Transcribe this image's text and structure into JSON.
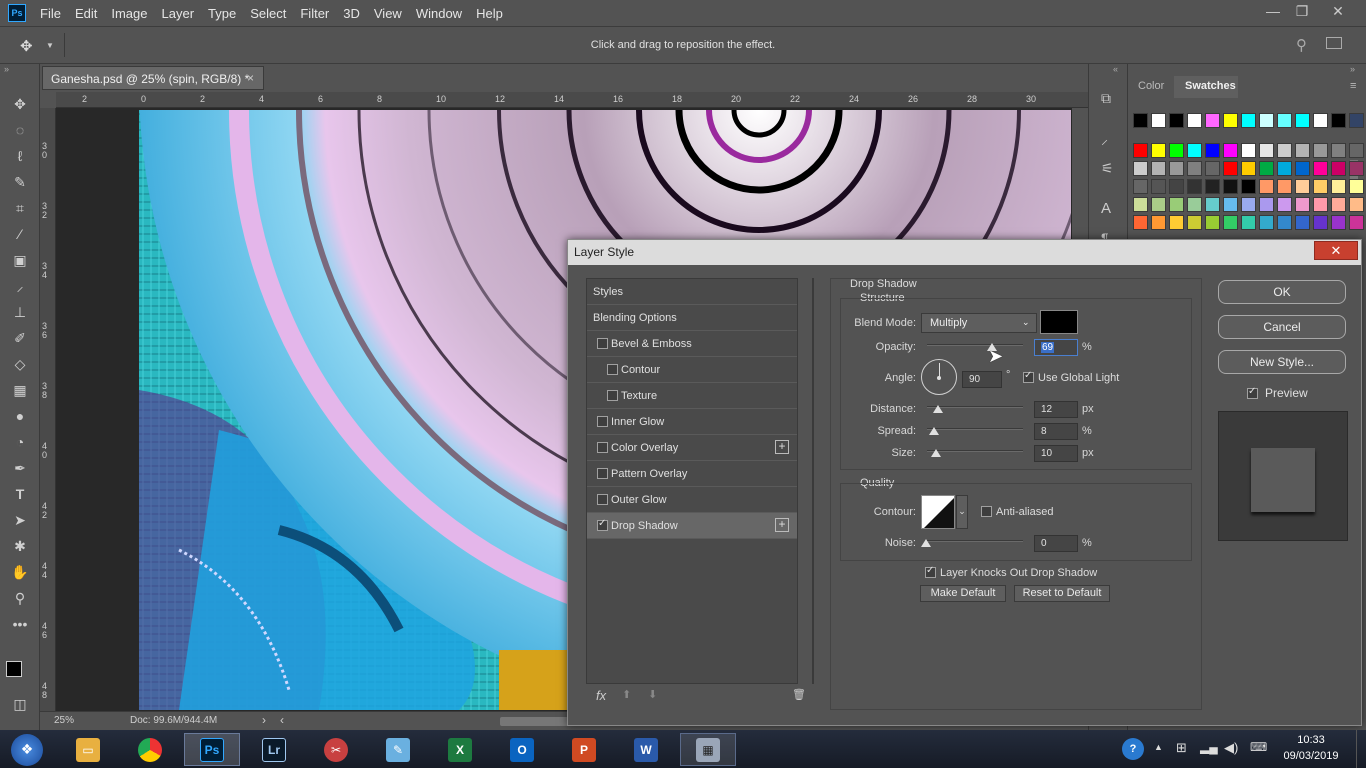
{
  "app": {
    "logo_text": "Ps"
  },
  "menu": [
    "File",
    "Edit",
    "Image",
    "Layer",
    "Type",
    "Select",
    "Filter",
    "3D",
    "View",
    "Window",
    "Help"
  ],
  "window_controls": {
    "minimize": "—",
    "restore": "❐",
    "close": "✕"
  },
  "options_bar": {
    "hint": "Click and drag to reposition the effect."
  },
  "document_tab": {
    "title": "Ganesha.psd @ 25% (spin, RGB/8) *",
    "close": "×"
  },
  "ruler_top": [
    "2",
    "0",
    "2",
    "4",
    "6",
    "8",
    "10",
    "12",
    "14",
    "16",
    "18",
    "20",
    "22",
    "24",
    "26",
    "28",
    "30"
  ],
  "ruler_left": [
    "3 0",
    "3 2",
    "3 4",
    "3 6",
    "3 8",
    "4 0",
    "4 2",
    "4 4",
    "4 6",
    "4 8"
  ],
  "status_bar": {
    "zoom": "25%",
    "doc": "Doc: 99.6M/944.4M"
  },
  "panels": {
    "color_tab": "Color",
    "swatches_tab": "Swatches"
  },
  "swatch_colors": {
    "row1": [
      "#000000",
      "#ffffff",
      "#000000",
      "#ffffff",
      "#ff66ff",
      "#ffff00",
      "#00ffff",
      "#ccffff",
      "#66ffff",
      "#00ffff",
      "#ffffff",
      "#000000",
      "#334466",
      "#222266"
    ],
    "row2": [
      "#ff0000",
      "#ffff00",
      "#00ff00",
      "#00ffff",
      "#0000ff",
      "#ff00ff",
      "#ffffff",
      "#e6e6e6",
      "#cccccc",
      "#b3b3b3",
      "#999999",
      "#808080",
      "#666666"
    ],
    "row3": [
      "#cccccc",
      "#b3b3b3",
      "#999999",
      "#808080",
      "#666666",
      "#ff0000",
      "#ffcc00",
      "#00aa44",
      "#00aadd",
      "#0066cc",
      "#ff0099",
      "#cc0066",
      "#993366"
    ],
    "row4": [
      "#666666",
      "#555555",
      "#444444",
      "#333333",
      "#222222",
      "#111111",
      "#000000",
      "#ff9966",
      "#ff9966",
      "#ffcc99",
      "#ffcc66",
      "#ffee99",
      "#ffff99"
    ],
    "row5": [
      "#ccdd99",
      "#aacc88",
      "#99cc77",
      "#99cc99",
      "#66cccc",
      "#66bbee",
      "#99aaee",
      "#aa99ee",
      "#cc99ee",
      "#ee99cc",
      "#ff99aa",
      "#ffaa99",
      "#ffbb88"
    ],
    "row6": [
      "#ff6633",
      "#ff9933",
      "#ffcc33",
      "#cccc33",
      "#99cc33",
      "#33cc66",
      "#33ccaa",
      "#33aacc",
      "#3388cc",
      "#3366cc",
      "#6633cc",
      "#9933cc",
      "#cc3399"
    ]
  },
  "dialog": {
    "title": "Layer Style",
    "close": "✕",
    "styles": [
      {
        "label": "Styles",
        "checkbox": false,
        "plus": false,
        "indent": 0
      },
      {
        "label": "Blending Options",
        "checkbox": false,
        "plus": false,
        "indent": 0
      },
      {
        "label": "Bevel & Emboss",
        "checkbox": true,
        "checked": false,
        "plus": false,
        "indent": 0
      },
      {
        "label": "Contour",
        "checkbox": true,
        "checked": false,
        "plus": false,
        "indent": 1
      },
      {
        "label": "Texture",
        "checkbox": true,
        "checked": false,
        "plus": false,
        "indent": 1
      },
      {
        "label": "Inner Glow",
        "checkbox": true,
        "checked": false,
        "plus": false,
        "indent": 0
      },
      {
        "label": "Color Overlay",
        "checkbox": true,
        "checked": false,
        "plus": true,
        "indent": 0
      },
      {
        "label": "Pattern Overlay",
        "checkbox": true,
        "checked": false,
        "plus": false,
        "indent": 0
      },
      {
        "label": "Outer Glow",
        "checkbox": true,
        "checked": false,
        "plus": false,
        "indent": 0
      },
      {
        "label": "Drop Shadow",
        "checkbox": true,
        "checked": true,
        "plus": true,
        "indent": 0
      }
    ],
    "bottom_icons": {
      "fx": "fx",
      "up": "⬆",
      "down": "⬇",
      "trash": "🗑"
    },
    "section_title": "Drop Shadow",
    "structure_title": "Structure",
    "blend_mode_label": "Blend Mode:",
    "blend_mode_value": "Multiply",
    "shadow_color": "#000000",
    "opacity_label": "Opacity:",
    "opacity_value": "69",
    "angle_label": "Angle:",
    "angle_value": "90",
    "degree_symbol": "°",
    "use_global_light": "Use Global Light",
    "distance_label": "Distance:",
    "distance_value": "12",
    "spread_label": "Spread:",
    "spread_value": "8",
    "size_label": "Size:",
    "size_value": "10",
    "quality_title": "Quality",
    "contour_label": "Contour:",
    "anti_aliased": "Anti-aliased",
    "noise_label": "Noise:",
    "noise_value": "0",
    "unit_percent": "%",
    "unit_px": "px",
    "layer_knocks_out": "Layer Knocks Out Drop Shadow",
    "make_default": "Make Default",
    "reset_default": "Reset to Default",
    "ok": "OK",
    "cancel": "Cancel",
    "new_style": "New Style...",
    "preview": "Preview"
  },
  "taskbar": {
    "time": "10:33",
    "date": "09/03/2019",
    "apps": [
      "Start",
      "File Explorer",
      "Chrome",
      "Photoshop",
      "Lightroom",
      "Snipping Tool",
      "Notepad",
      "Excel",
      "Outlook",
      "PowerPoint",
      "Word",
      "Calculator"
    ],
    "icon_labels": {
      "photoshop": "Ps",
      "lightroom": "Lr",
      "excel": "X",
      "outlook": "O",
      "powerpoint": "P",
      "word": "W"
    }
  }
}
